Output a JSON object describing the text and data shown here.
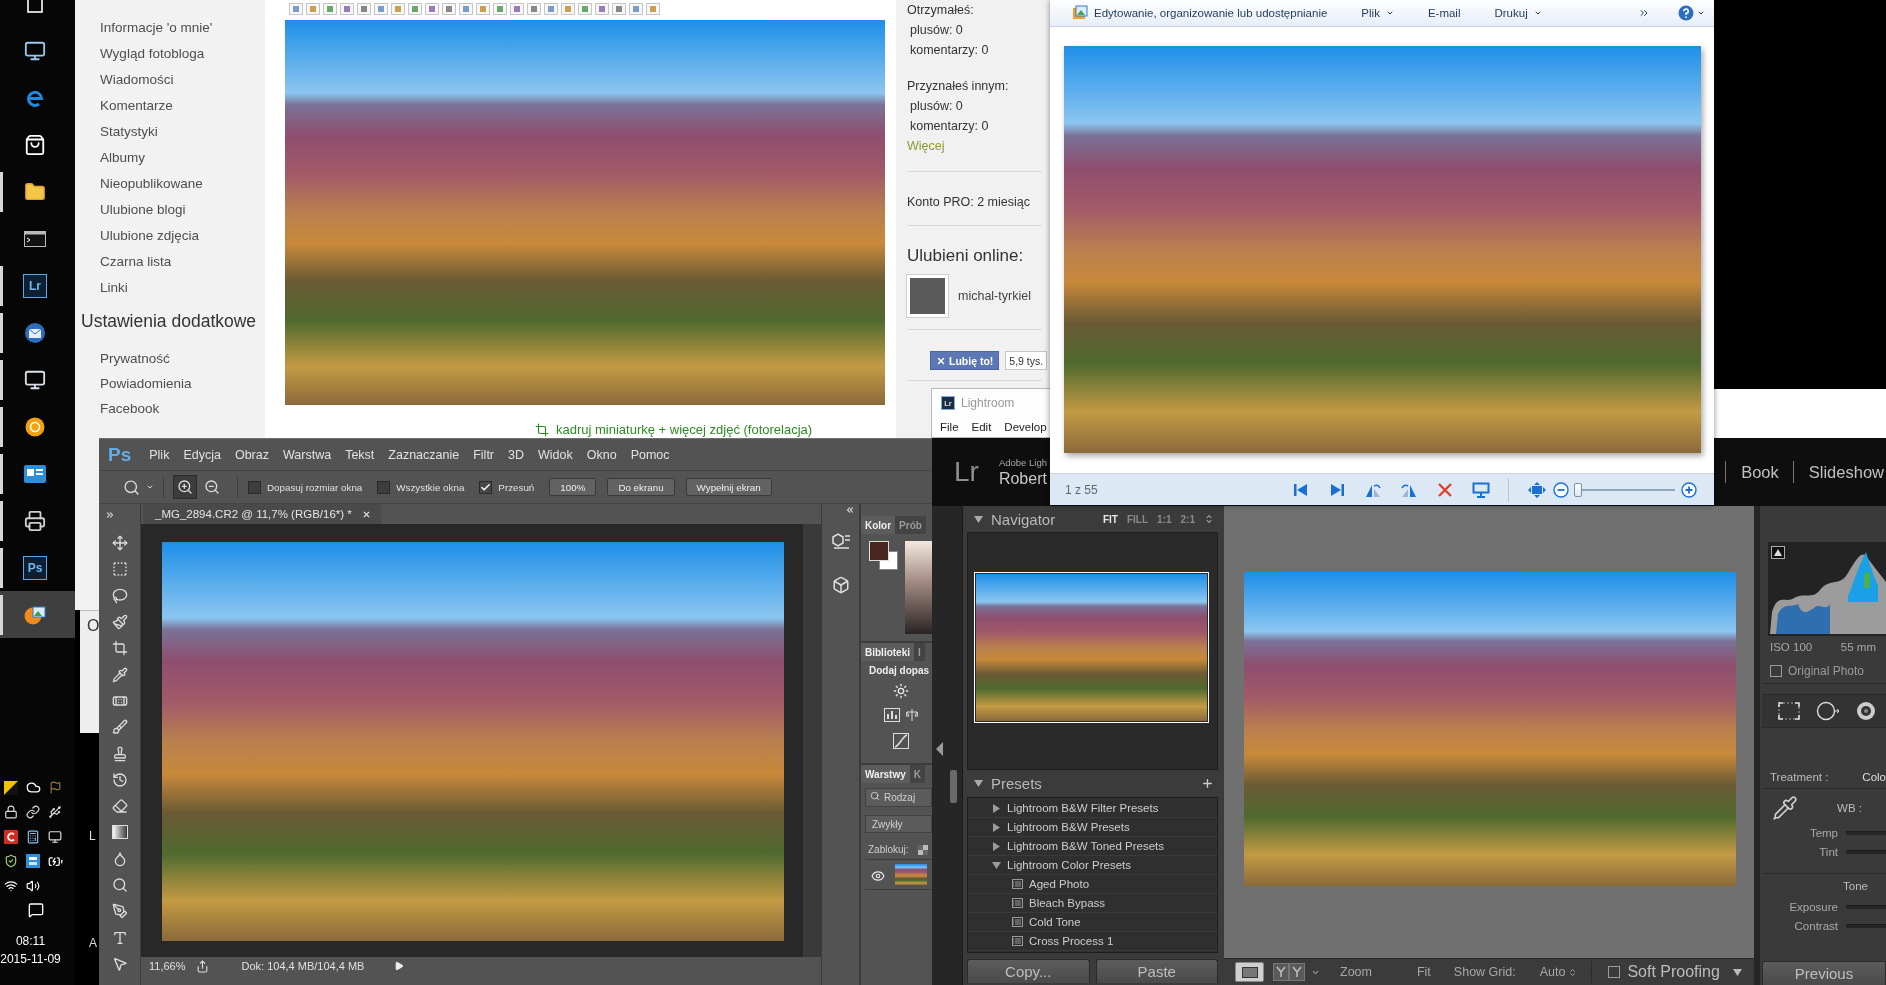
{
  "taskbar": {
    "apps": [
      {
        "kind": "task-view",
        "running": false,
        "selected": false
      },
      {
        "kind": "computer",
        "running": false,
        "selected": false
      },
      {
        "kind": "edge",
        "running": false,
        "selected": false
      },
      {
        "kind": "store",
        "running": false,
        "selected": false
      },
      {
        "kind": "folder",
        "running": true,
        "selected": false
      },
      {
        "kind": "terminal",
        "running": false,
        "selected": false
      },
      {
        "kind": "badge",
        "label": "Lr",
        "running": true,
        "selected": false
      },
      {
        "kind": "mail",
        "running": true,
        "selected": false
      },
      {
        "kind": "monitor",
        "running": true,
        "selected": false
      },
      {
        "kind": "ring",
        "running": true,
        "selected": false
      },
      {
        "kind": "card",
        "running": true,
        "selected": false
      },
      {
        "kind": "printer",
        "running": true,
        "selected": false
      },
      {
        "kind": "badge",
        "label": "Ps",
        "running": true,
        "selected": false
      },
      {
        "kind": "viewer",
        "running": true,
        "selected": true
      }
    ],
    "clock": {
      "time": "08:11",
      "date": "2015-11-09"
    }
  },
  "desktop_fragments": {
    "window_letter": "O",
    "letters": [
      "L",
      "A"
    ]
  },
  "blog": {
    "sidebar": {
      "items": [
        "Informacje 'o mnie'",
        "Wygląd fotobloga",
        "Wiadomości",
        "Komentarze",
        "Statystyki",
        "Albumy",
        "Nieopublikowane",
        "Ulubione blogi",
        "Ulubione zdjęcia",
        "Czarna lista",
        "Linki"
      ],
      "heading": "Ustawienia dodatkowe",
      "settings": [
        "Prywatność",
        "Powiadomienia",
        "Facebook"
      ]
    },
    "photo_link": "kadruj miniaturkę + więcej zdjęć (fotorelacja)",
    "stats": [
      {
        "heading": "Otrzymałeś:",
        "lines": [
          "plusów: 0",
          "komentarzy: 0"
        ]
      },
      {
        "heading": "Przyznałeś innym:",
        "lines": [
          "plusów: 0",
          "komentarzy: 0"
        ]
      }
    ],
    "more_link": "Więcej",
    "pro_account": "Konto PRO: 2 miesiąc",
    "favorites": {
      "title": "Ulubieni online:",
      "users": [
        {
          "name": "michal-tyrkiel"
        }
      ]
    },
    "like": {
      "label": "Lubię to!",
      "count": "5,9 tys."
    }
  },
  "lightroom_small": {
    "logo": "Lr",
    "title": "Lightroom",
    "menu": [
      "File",
      "Edit",
      "Develop"
    ]
  },
  "photo_viewer": {
    "toolbar": [
      {
        "kind": "app",
        "label": "Edytowanie, organizowanie lub udostępnianie"
      },
      {
        "kind": "menu",
        "label": "Plik"
      },
      {
        "kind": "plain",
        "label": "E-mail"
      },
      {
        "kind": "menu",
        "label": "Drukuj"
      }
    ],
    "counter": "1 z 55",
    "zoom": {
      "level": 0.03
    }
  },
  "photoshop": {
    "logo": "Ps",
    "menu": [
      "Plik",
      "Edycja",
      "Obraz",
      "Warstwa",
      "Tekst",
      "Zaznaczanie",
      "Filtr",
      "3D",
      "Widok",
      "Okno",
      "Pomoc"
    ],
    "zoom_modes": [
      {
        "kind": "zoom-in",
        "selected": true
      },
      {
        "kind": "zoom-out",
        "selected": false
      }
    ],
    "options": {
      "checkboxes": [
        {
          "label": "Dopasuj rozmiar okna",
          "checked": false
        },
        {
          "label": "Wszystkie okna",
          "checked": false
        },
        {
          "label": "Przesuń",
          "checked": true
        }
      ],
      "buttons": [
        "100%",
        "Do ekranu",
        "Wypełnij ekran"
      ]
    },
    "document_tab": "_MG_2894.CR2 @ 11,7% (RGB/16*) *",
    "status": {
      "zoom": "11,66%",
      "document": "Dok: 104,4 MB/104,4 MB"
    },
    "panels": {
      "color_tabs": [
        {
          "label": "Kolor",
          "selected": true
        },
        {
          "label": "Prób",
          "selected": false
        }
      ],
      "library_tabs": [
        {
          "label": "Biblioteki",
          "selected": true
        },
        {
          "label": "I",
          "selected": false
        }
      ],
      "adjustments_title": "Dodaj dopas",
      "layer_tabs": [
        {
          "label": "Warstwy",
          "selected": true
        },
        {
          "label": "K",
          "selected": false
        }
      ],
      "layer_filter": {
        "placeholder": "Rodzaj"
      },
      "blend_mode": "Zwykły",
      "lock_label": "Zablokuj:",
      "layers": [
        {
          "visible": true
        }
      ]
    }
  },
  "lightroom": {
    "logo": "Lr",
    "identity": {
      "product": "Adobe Ligh",
      "user": "Robert"
    },
    "modules": [
      {
        "label": "Book",
        "selected": false
      },
      {
        "label": "Slideshow",
        "selected": false
      }
    ],
    "navigator": {
      "title": "Navigator",
      "zoom_options": [
        {
          "label": "FIT",
          "selected": true
        },
        {
          "label": "FILL",
          "selected": false
        },
        {
          "label": "1:1",
          "selected": false
        },
        {
          "label": "2:1",
          "selected": false
        }
      ]
    },
    "presets": {
      "title": "Presets",
      "folders": [
        {
          "name": "Lightroom B&W Filter Presets",
          "expanded": false
        },
        {
          "name": "Lightroom B&W Presets",
          "expanded": false
        },
        {
          "name": "Lightroom B&W Toned Presets",
          "expanded": false
        },
        {
          "name": "Lightroom Color Presets",
          "expanded": true,
          "children": [
            {
              "name": "Aged Photo"
            },
            {
              "name": "Bleach Bypass"
            },
            {
              "name": "Cold Tone"
            },
            {
              "name": "Cross Process 1"
            }
          ]
        }
      ]
    },
    "panel_buttons": [
      "Copy...",
      "Paste"
    ],
    "toolbar": {
      "zoom_label": "Zoom",
      "zoom_value": "Fit",
      "grid_label": "Show Grid:",
      "grid_value": "Auto",
      "soft_proofing": {
        "label": "Soft Proofing",
        "checked": false
      }
    },
    "histogram_info": [
      "ISO 100",
      "55 mm"
    ],
    "original_photo": {
      "label": "Original Photo",
      "checked": false
    },
    "basic": {
      "treatment_label": "Treatment :",
      "treatment_value": "Colo",
      "wb_label": "WB :",
      "wb_sliders": [
        "Temp",
        "Tint"
      ],
      "tone_title": "Tone",
      "tone_sliders": [
        "Exposure",
        "Contrast"
      ]
    },
    "previous_button": "Previous"
  }
}
